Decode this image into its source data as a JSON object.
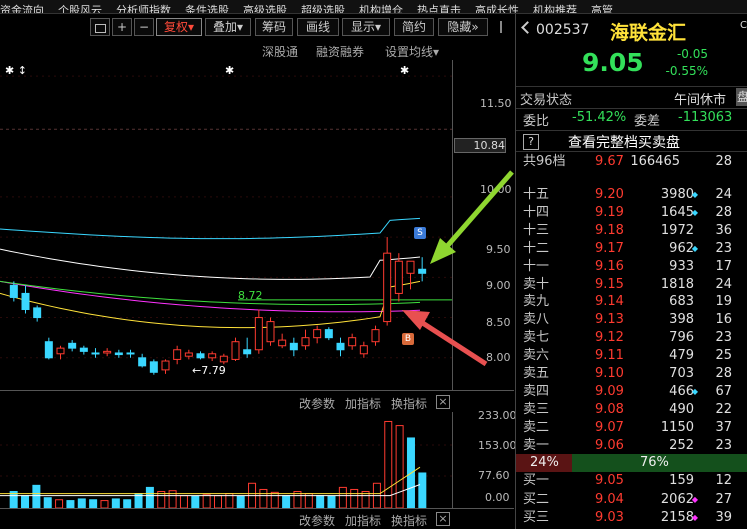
{
  "top_menu": [
    "资金流向",
    "个股风云",
    "分析师指数",
    "条件选股",
    "高级选股",
    "超级选股",
    "机构增仓",
    "热点直击",
    "高成长性",
    "机构推荐",
    "高管"
  ],
  "toolbar": {
    "lock_icon": "lock-icon",
    "plus": "+",
    "minus": "−",
    "fuquan": "复权",
    "fuquan_arrow": "▾",
    "diejia": "叠加",
    "diejia_arrow": "▾",
    "chouma": "筹码",
    "huaxian": "画线",
    "xianshi": "显示",
    "xianshi_arrow": "▾",
    "jianyue": "简约",
    "yincang": "隐藏",
    "yincang_arrow": "»"
  },
  "subtoolbar": {
    "shengutong": "深股通",
    "rongzi": "融资融券",
    "set_ma": "设置均线",
    "arrow": "▾"
  },
  "price_axis": [
    "11.50",
    "10.84",
    "10.00",
    "9.50",
    "9.00",
    "8.50",
    "8.00"
  ],
  "labels": {
    "ma_value": "8.72",
    "low_value": "←7.79",
    "s_mark": "S",
    "b_mark": "B",
    "stars_left": "✱ ↕",
    "star_mid": "✱",
    "star_right": "✱"
  },
  "indicator_toolbar": {
    "gaicanshu": "改参数",
    "jiazhibiao": "加指标",
    "huanzhibiao": "换指标",
    "close": "×"
  },
  "volume_axis": [
    "233.00",
    "153.00",
    "77.60",
    "0.00"
  ],
  "bottom_toolbar": {
    "gaicanshu": "改参数",
    "jiazhibiao": "加指标",
    "huanzhibiao": "换指标",
    "close": "×"
  },
  "chart_data": {
    "type": "candlestick",
    "ylim": [
      7.6,
      11.7
    ],
    "candles": [
      {
        "o": 8.9,
        "h": 8.95,
        "l": 8.7,
        "c": 8.75,
        "up": false
      },
      {
        "o": 8.8,
        "h": 8.9,
        "l": 8.55,
        "c": 8.6,
        "up": false
      },
      {
        "o": 8.62,
        "h": 8.65,
        "l": 8.45,
        "c": 8.5,
        "up": false
      },
      {
        "o": 8.2,
        "h": 8.25,
        "l": 7.98,
        "c": 8.0,
        "up": false
      },
      {
        "o": 8.05,
        "h": 8.15,
        "l": 7.98,
        "c": 8.12,
        "up": true
      },
      {
        "o": 8.18,
        "h": 8.22,
        "l": 8.08,
        "c": 8.12,
        "up": false
      },
      {
        "o": 8.12,
        "h": 8.15,
        "l": 8.04,
        "c": 8.08,
        "up": false
      },
      {
        "o": 8.05,
        "h": 8.12,
        "l": 8.0,
        "c": 8.06,
        "up": false
      },
      {
        "o": 8.06,
        "h": 8.12,
        "l": 8.02,
        "c": 8.08,
        "up": true
      },
      {
        "o": 8.06,
        "h": 8.1,
        "l": 8.0,
        "c": 8.04,
        "up": false
      },
      {
        "o": 8.05,
        "h": 8.1,
        "l": 8.0,
        "c": 8.06,
        "up": false
      },
      {
        "o": 8.0,
        "h": 8.05,
        "l": 7.88,
        "c": 7.9,
        "up": false
      },
      {
        "o": 7.95,
        "h": 7.98,
        "l": 7.79,
        "c": 7.82,
        "up": false
      },
      {
        "o": 7.85,
        "h": 7.98,
        "l": 7.8,
        "c": 7.96,
        "up": true
      },
      {
        "o": 7.98,
        "h": 8.15,
        "l": 7.92,
        "c": 8.1,
        "up": true
      },
      {
        "o": 8.02,
        "h": 8.1,
        "l": 7.98,
        "c": 8.06,
        "up": true
      },
      {
        "o": 8.05,
        "h": 8.08,
        "l": 7.98,
        "c": 8.0,
        "up": false
      },
      {
        "o": 8.0,
        "h": 8.08,
        "l": 7.96,
        "c": 8.05,
        "up": true
      },
      {
        "o": 8.02,
        "h": 8.05,
        "l": 7.92,
        "c": 7.95,
        "up": true
      },
      {
        "o": 7.98,
        "h": 8.25,
        "l": 7.96,
        "c": 8.2,
        "up": true
      },
      {
        "o": 8.05,
        "h": 8.25,
        "l": 8.0,
        "c": 8.1,
        "up": false
      },
      {
        "o": 8.1,
        "h": 8.6,
        "l": 8.05,
        "c": 8.5,
        "up": true
      },
      {
        "o": 8.45,
        "h": 8.5,
        "l": 8.15,
        "c": 8.2,
        "up": true
      },
      {
        "o": 8.22,
        "h": 8.3,
        "l": 8.12,
        "c": 8.15,
        "up": true
      },
      {
        "o": 8.1,
        "h": 8.25,
        "l": 8.02,
        "c": 8.18,
        "up": false
      },
      {
        "o": 8.15,
        "h": 8.35,
        "l": 8.1,
        "c": 8.25,
        "up": true
      },
      {
        "o": 8.25,
        "h": 8.4,
        "l": 8.18,
        "c": 8.35,
        "up": true
      },
      {
        "o": 8.35,
        "h": 8.38,
        "l": 8.22,
        "c": 8.25,
        "up": false
      },
      {
        "o": 8.1,
        "h": 8.25,
        "l": 8.02,
        "c": 8.18,
        "up": false
      },
      {
        "o": 8.15,
        "h": 8.3,
        "l": 8.1,
        "c": 8.25,
        "up": true
      },
      {
        "o": 8.05,
        "h": 8.2,
        "l": 8.0,
        "c": 8.15,
        "up": true
      },
      {
        "o": 8.2,
        "h": 8.4,
        "l": 8.15,
        "c": 8.35,
        "up": true
      },
      {
        "o": 8.45,
        "h": 9.5,
        "l": 8.4,
        "c": 9.3,
        "up": true
      },
      {
        "o": 8.8,
        "h": 9.3,
        "l": 8.7,
        "c": 9.2,
        "up": true
      },
      {
        "o": 9.2,
        "h": 9.15,
        "l": 8.85,
        "c": 9.05,
        "up": true
      },
      {
        "o": 9.1,
        "h": 9.25,
        "l": 8.95,
        "c": 9.05,
        "up": false
      }
    ],
    "volumes": [
      40,
      30,
      55,
      25,
      20,
      18,
      22,
      20,
      18,
      22,
      20,
      35,
      50,
      40,
      42,
      30,
      28,
      32,
      30,
      35,
      28,
      60,
      45,
      38,
      30,
      40,
      35,
      30,
      28,
      50,
      45,
      40,
      60,
      210,
      200,
      170,
      85
    ]
  },
  "quote": {
    "code": "002537",
    "name": "海联金汇",
    "c_mark": "C",
    "price": "9.05",
    "change": "-0.05",
    "change_pct": "-0.55%",
    "status_label": "交易状态",
    "status_value": "午间休市",
    "weibi_label": "委比",
    "weibi_value": "-51.42%",
    "weicha_label": "委差",
    "weicha_value": "-113063",
    "question": "?",
    "full_book": "查看完整档买卖盘",
    "total_label": "共96档",
    "total_price": "9.67",
    "total_vol": "166465",
    "total_cnt": "28",
    "side_tab": "盘"
  },
  "asks": [
    {
      "label": "十五",
      "price": "9.20",
      "vol": "3980",
      "dot": "cyan",
      "cnt": "24"
    },
    {
      "label": "十四",
      "price": "9.19",
      "vol": "1645",
      "dot": "cyan",
      "cnt": "28"
    },
    {
      "label": "十三",
      "price": "9.18",
      "vol": "1972",
      "dot": "",
      "cnt": "36"
    },
    {
      "label": "十二",
      "price": "9.17",
      "vol": "962",
      "dot": "cyan",
      "cnt": "23"
    },
    {
      "label": "十一",
      "price": "9.16",
      "vol": "933",
      "dot": "",
      "cnt": "17"
    },
    {
      "label": "卖十",
      "price": "9.15",
      "vol": "1818",
      "dot": "",
      "cnt": "24"
    },
    {
      "label": "卖九",
      "price": "9.14",
      "vol": "683",
      "dot": "",
      "cnt": "19"
    },
    {
      "label": "卖八",
      "price": "9.13",
      "vol": "398",
      "dot": "",
      "cnt": "16"
    },
    {
      "label": "卖七",
      "price": "9.12",
      "vol": "796",
      "dot": "",
      "cnt": "23"
    },
    {
      "label": "卖六",
      "price": "9.11",
      "vol": "479",
      "dot": "",
      "cnt": "25"
    },
    {
      "label": "卖五",
      "price": "9.10",
      "vol": "703",
      "dot": "",
      "cnt": "28"
    },
    {
      "label": "卖四",
      "price": "9.09",
      "vol": "466",
      "dot": "cyan",
      "cnt": "67"
    },
    {
      "label": "卖三",
      "price": "9.08",
      "vol": "490",
      "dot": "",
      "cnt": "22"
    },
    {
      "label": "卖二",
      "price": "9.07",
      "vol": "1150",
      "dot": "",
      "cnt": "37"
    },
    {
      "label": "卖一",
      "price": "9.06",
      "vol": "252",
      "dot": "",
      "cnt": "23"
    }
  ],
  "ratio": {
    "left": "24%",
    "right": "76%",
    "left_frac": 0.24
  },
  "bids": [
    {
      "label": "买一",
      "price": "9.05",
      "vol": "159",
      "dot": "",
      "cnt": "12"
    },
    {
      "label": "买二",
      "price": "9.04",
      "vol": "2062",
      "dot": "mag",
      "cnt": "27"
    },
    {
      "label": "买三",
      "price": "9.03",
      "vol": "2158",
      "dot": "mag",
      "cnt": "39"
    }
  ]
}
